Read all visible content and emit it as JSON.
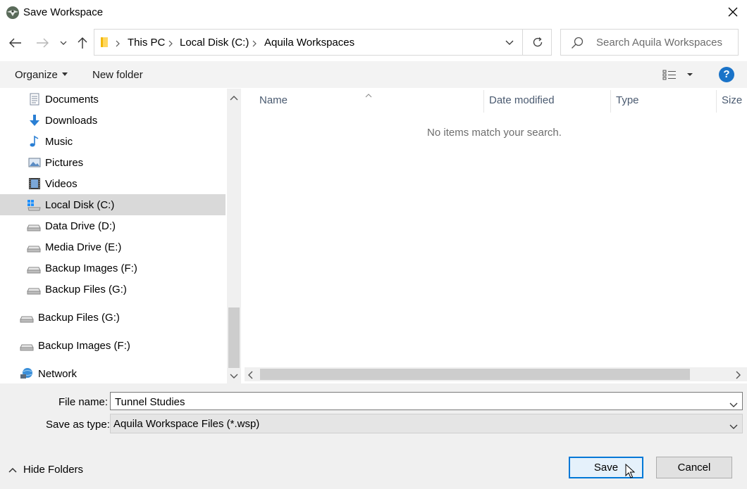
{
  "window": {
    "title": "Save Workspace",
    "icon": "aquila-eagle-icon"
  },
  "navigation": {
    "breadcrumbs": [
      "This PC",
      "Local Disk (C:)",
      "Aquila Workspaces"
    ],
    "search_placeholder": "Search Aquila Workspaces"
  },
  "toolbar": {
    "organize_label": "Organize",
    "new_folder_label": "New folder",
    "help_label": "?"
  },
  "sidebar": {
    "items": [
      {
        "label": "Documents",
        "icon": "documents-icon"
      },
      {
        "label": "Downloads",
        "icon": "downloads-icon"
      },
      {
        "label": "Music",
        "icon": "music-icon"
      },
      {
        "label": "Pictures",
        "icon": "pictures-icon"
      },
      {
        "label": "Videos",
        "icon": "videos-icon"
      },
      {
        "label": "Local Disk (C:)",
        "icon": "windows-drive-icon",
        "selected": true
      },
      {
        "label": "Data Drive (D:)",
        "icon": "drive-icon"
      },
      {
        "label": "Media Drive (E:)",
        "icon": "drive-icon"
      },
      {
        "label": "Backup Images (F:)",
        "icon": "drive-icon"
      },
      {
        "label": "Backup Files (G:)",
        "icon": "drive-icon"
      },
      {
        "label": "Backup Files (G:)",
        "icon": "drive-icon"
      },
      {
        "label": "Backup Images (F:)",
        "icon": "drive-icon"
      },
      {
        "label": "Network",
        "icon": "network-icon"
      }
    ]
  },
  "file_list": {
    "columns": [
      "Name",
      "Date modified",
      "Type",
      "Size"
    ],
    "empty_message": "No items match your search."
  },
  "form": {
    "file_name_label": "File name:",
    "file_name_value": "Tunnel Studies",
    "save_type_label": "Save as type:",
    "save_type_value": "Aquila Workspace Files (*.wsp)"
  },
  "footer": {
    "hide_folders_label": "Hide Folders",
    "save_label": "Save",
    "cancel_label": "Cancel"
  },
  "colors": {
    "accent": "#0078d7",
    "selection": "#d9d9d9",
    "toolbar_bg": "#f3f3f3",
    "help_blue": "#1a73c8"
  }
}
